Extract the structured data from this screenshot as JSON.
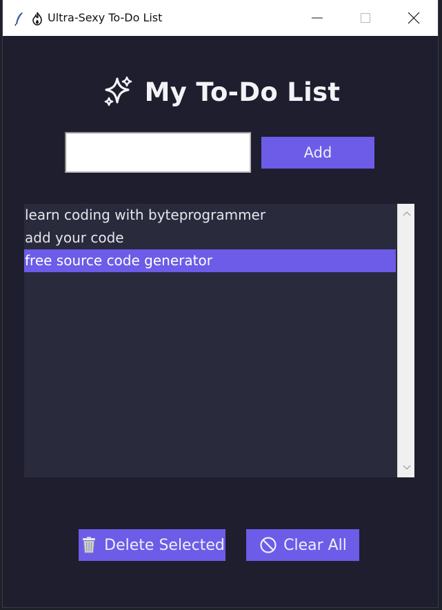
{
  "window": {
    "title": "Ultra-Sexy To-Do List"
  },
  "heading": {
    "text": "My To-Do List",
    "icon": "sparkle-icon"
  },
  "entry": {
    "value": "",
    "placeholder": ""
  },
  "buttons": {
    "add_label": "Add",
    "delete_label": "Delete Selected",
    "clear_label": "Clear All"
  },
  "tasks": [
    {
      "text": "learn coding with byteprogrammer",
      "selected": false
    },
    {
      "text": "add your code",
      "selected": false
    },
    {
      "text": "free source code generator",
      "selected": true
    }
  ],
  "colors": {
    "background": "#1e1e2e",
    "list_background": "#2a2a3d",
    "accent": "#6c5ce7",
    "text": "#e6e6ee"
  }
}
